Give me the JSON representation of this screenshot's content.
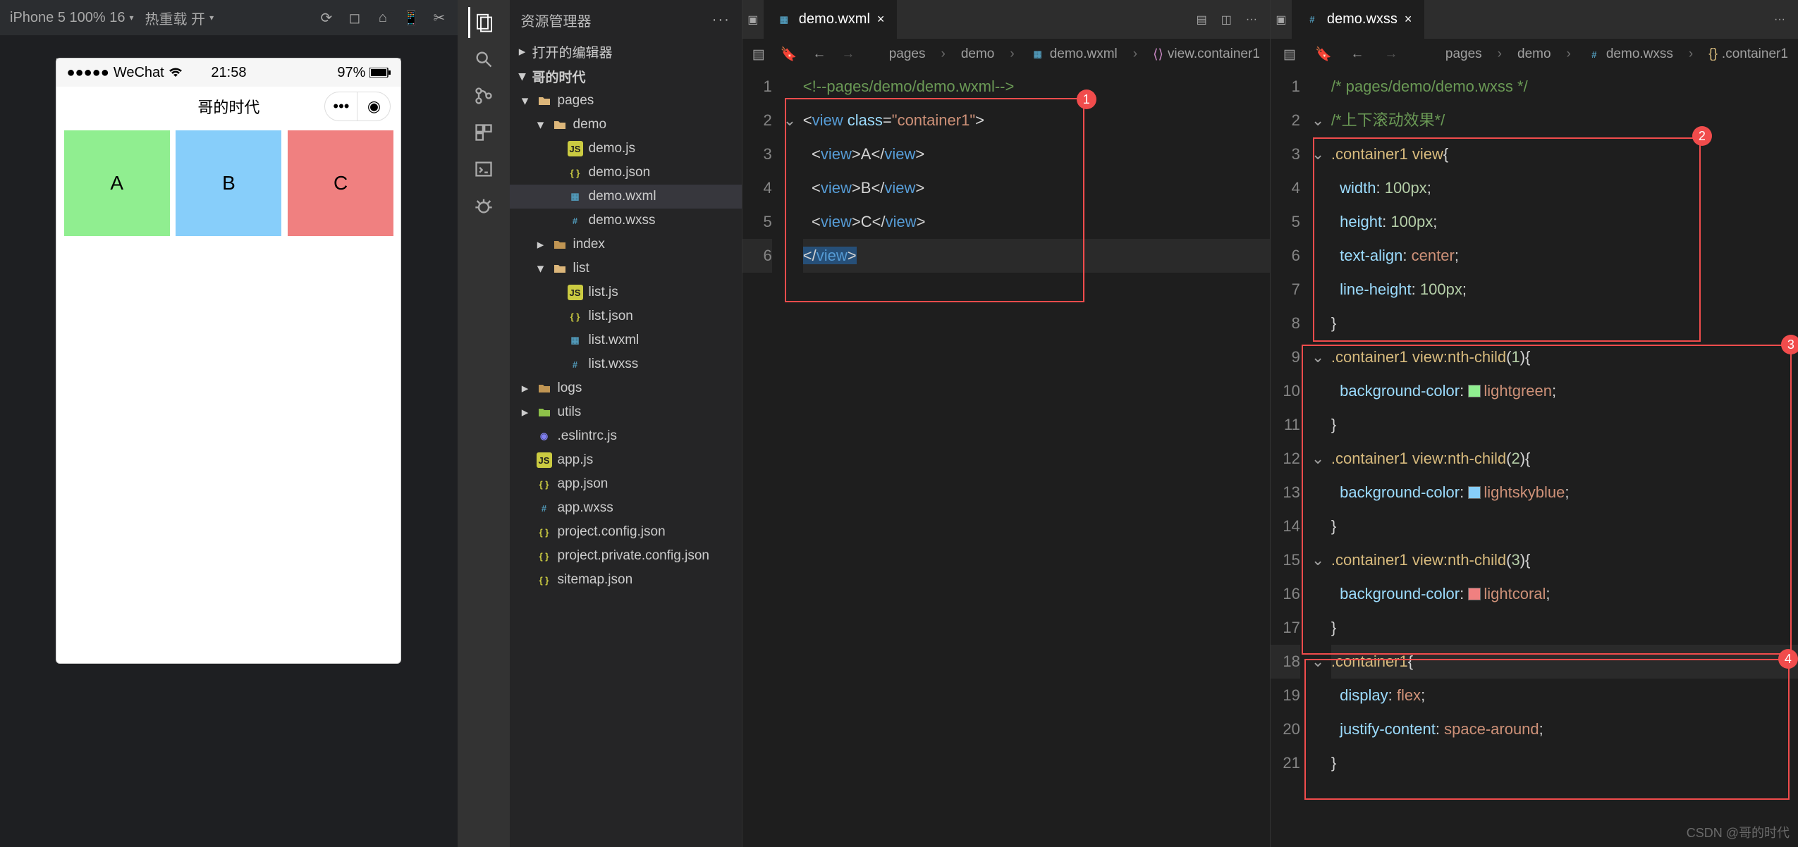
{
  "sim": {
    "device": "iPhone 5 100% 16",
    "hotreload": "热重载 开",
    "phone": {
      "carrier": "WeChat",
      "time": "21:58",
      "battery": "97%",
      "title": "哥的时代",
      "boxes": [
        "A",
        "B",
        "C"
      ]
    }
  },
  "filePanel": {
    "title": "资源管理器",
    "sections": {
      "openEditors": "打开的编辑器",
      "project": "哥的时代"
    },
    "tree": {
      "pages": "pages",
      "demo": "demo",
      "demo_items": [
        "demo.js",
        "demo.json",
        "demo.wxml",
        "demo.wxss"
      ],
      "index": "index",
      "list": "list",
      "list_items": [
        "list.js",
        "list.json",
        "list.wxml",
        "list.wxss"
      ],
      "logs": "logs",
      "utils": "utils",
      "root_files": [
        ".eslintrc.js",
        "app.js",
        "app.json",
        "app.wxss",
        "project.config.json",
        "project.private.config.json",
        "sitemap.json"
      ]
    }
  },
  "editor1": {
    "tab": "demo.wxml",
    "crumbs": [
      "pages",
      "demo",
      "demo.wxml",
      "view.container1"
    ],
    "lines": [
      {
        "n": 1,
        "html": "<span class='c-com'>&lt;!--pages/demo/demo.wxml--&gt;</span>"
      },
      {
        "n": 2,
        "html": "<span class='c-pun'>&lt;</span><span class='c-tag'>view</span> <span class='c-attr'>class</span><span class='c-pun'>=</span><span class='c-str'>\"container1\"</span><span class='c-pun'>&gt;</span>"
      },
      {
        "n": 3,
        "html": "  <span class='c-pun'>&lt;</span><span class='c-tag'>view</span><span class='c-pun'>&gt;</span>A<span class='c-pun'>&lt;/</span><span class='c-tag'>view</span><span class='c-pun'>&gt;</span>"
      },
      {
        "n": 4,
        "html": "  <span class='c-pun'>&lt;</span><span class='c-tag'>view</span><span class='c-pun'>&gt;</span>B<span class='c-pun'>&lt;/</span><span class='c-tag'>view</span><span class='c-pun'>&gt;</span>"
      },
      {
        "n": 5,
        "html": "  <span class='c-pun'>&lt;</span><span class='c-tag'>view</span><span class='c-pun'>&gt;</span>C<span class='c-pun'>&lt;/</span><span class='c-tag'>view</span><span class='c-pun'>&gt;</span>"
      },
      {
        "n": 6,
        "html": "<span class='seltag'><span class='c-pun'>&lt;/</span><span class='c-tag'>view</span><span class='c-pun'>&gt;</span></span>",
        "hl": true
      }
    ],
    "annot": {
      "label": "1"
    }
  },
  "editor2": {
    "tab": "demo.wxss",
    "crumbs": [
      "pages",
      "demo",
      "demo.wxss",
      ".container1"
    ],
    "lines": [
      {
        "n": 1,
        "html": "<span class='c-com'>/* pages/demo/demo.wxss */</span>"
      },
      {
        "n": 2,
        "html": "<span class='c-com'>/*上下滚动效果*/</span>"
      },
      {
        "n": 3,
        "html": "<span class='c-sel'>.container1 view</span><span class='c-pun'>{</span>"
      },
      {
        "n": 4,
        "html": "  <span class='c-prop'>width</span><span class='c-pun'>:</span> <span class='c-num'>100px</span><span class='c-pun'>;</span>"
      },
      {
        "n": 5,
        "html": "  <span class='c-prop'>height</span><span class='c-pun'>:</span> <span class='c-num'>100px</span><span class='c-pun'>;</span>"
      },
      {
        "n": 6,
        "html": "  <span class='c-prop'>text-align</span><span class='c-pun'>:</span> <span class='c-val'>center</span><span class='c-pun'>;</span>"
      },
      {
        "n": 7,
        "html": "  <span class='c-prop'>line-height</span><span class='c-pun'>:</span> <span class='c-num'>100px</span><span class='c-pun'>;</span>"
      },
      {
        "n": 8,
        "html": "<span class='c-pun'>}</span>"
      },
      {
        "n": 9,
        "html": "<span class='c-sel'>.container1 view:nth-child</span><span class='c-pun'>(</span><span class='c-num'>1</span><span class='c-pun'>){</span>"
      },
      {
        "n": 10,
        "html": "  <span class='c-prop'>background-color</span><span class='c-pun'>:</span> <span class='color-swatch' style='background:lightgreen'></span><span class='c-val'>lightgreen</span><span class='c-pun'>;</span>"
      },
      {
        "n": 11,
        "html": "<span class='c-pun'>}</span>"
      },
      {
        "n": 12,
        "html": "<span class='c-sel'>.container1 view:nth-child</span><span class='c-pun'>(</span><span class='c-num'>2</span><span class='c-pun'>){</span>"
      },
      {
        "n": 13,
        "html": "  <span class='c-prop'>background-color</span><span class='c-pun'>:</span> <span class='color-swatch' style='background:lightskyblue'></span><span class='c-val'>lightskyblue</span><span class='c-pun'>;</span>"
      },
      {
        "n": 14,
        "html": "<span class='c-pun'>}</span>"
      },
      {
        "n": 15,
        "html": "<span class='c-sel'>.container1 view:nth-child</span><span class='c-pun'>(</span><span class='c-num'>3</span><span class='c-pun'>){</span>"
      },
      {
        "n": 16,
        "html": "  <span class='c-prop'>background-color</span><span class='c-pun'>:</span> <span class='color-swatch' style='background:lightcoral'></span><span class='c-val'>lightcoral</span><span class='c-pun'>;</span>"
      },
      {
        "n": 17,
        "html": "<span class='c-pun'>}</span>"
      },
      {
        "n": 18,
        "html": "<span class='c-sel'>.container1</span><span class='c-pun'>{</span>",
        "hl": true
      },
      {
        "n": 19,
        "html": "  <span class='c-prop'>display</span><span class='c-pun'>:</span> <span class='c-val'>flex</span><span class='c-pun'>;</span>"
      },
      {
        "n": 20,
        "html": "  <span class='c-prop'>justify-content</span><span class='c-pun'>:</span> <span class='c-val'>space-around</span><span class='c-pun'>;</span>"
      },
      {
        "n": 21,
        "html": "<span class='c-pun'>}</span>"
      }
    ],
    "annots": [
      {
        "label": "2"
      },
      {
        "label": "3"
      },
      {
        "label": "4"
      }
    ]
  },
  "watermark": "CSDN @哥的时代"
}
